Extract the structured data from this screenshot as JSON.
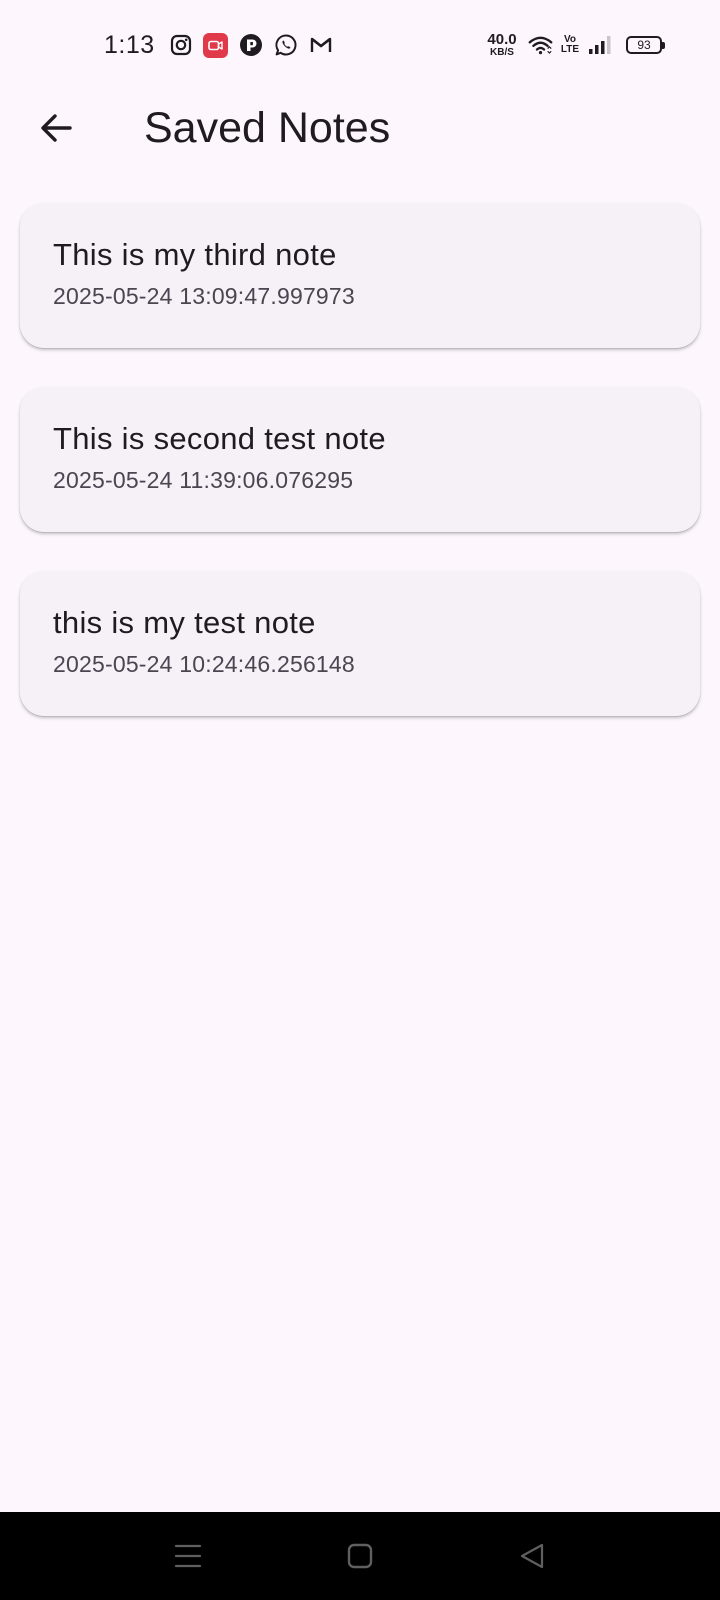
{
  "status_bar": {
    "time": "1:13",
    "net_speed_value": "40.0",
    "net_speed_unit": "KB/S",
    "volte_top": "Vo",
    "volte_bottom": "LTE",
    "battery_level": "93",
    "notification_icons": [
      "instagram-icon",
      "screen-recorder-icon",
      "app-notification-icon",
      "whatsapp-icon",
      "gmail-icon"
    ],
    "accent_recorder": "#e0394a"
  },
  "app_bar": {
    "title": "Saved Notes"
  },
  "notes": [
    {
      "title": "This is my third note",
      "date": "2025-05-24 13:09:47.997973"
    },
    {
      "title": "This is second test note",
      "date": "2025-05-24 11:39:06.076295"
    },
    {
      "title": "this is my test note",
      "date": "2025-05-24 10:24:46.256148"
    }
  ],
  "colors": {
    "background": "#fdf7fd",
    "card": "#f5f1f7",
    "text_primary": "#1f1b21",
    "text_secondary": "#4a4550",
    "nav_bar": "#000000"
  }
}
